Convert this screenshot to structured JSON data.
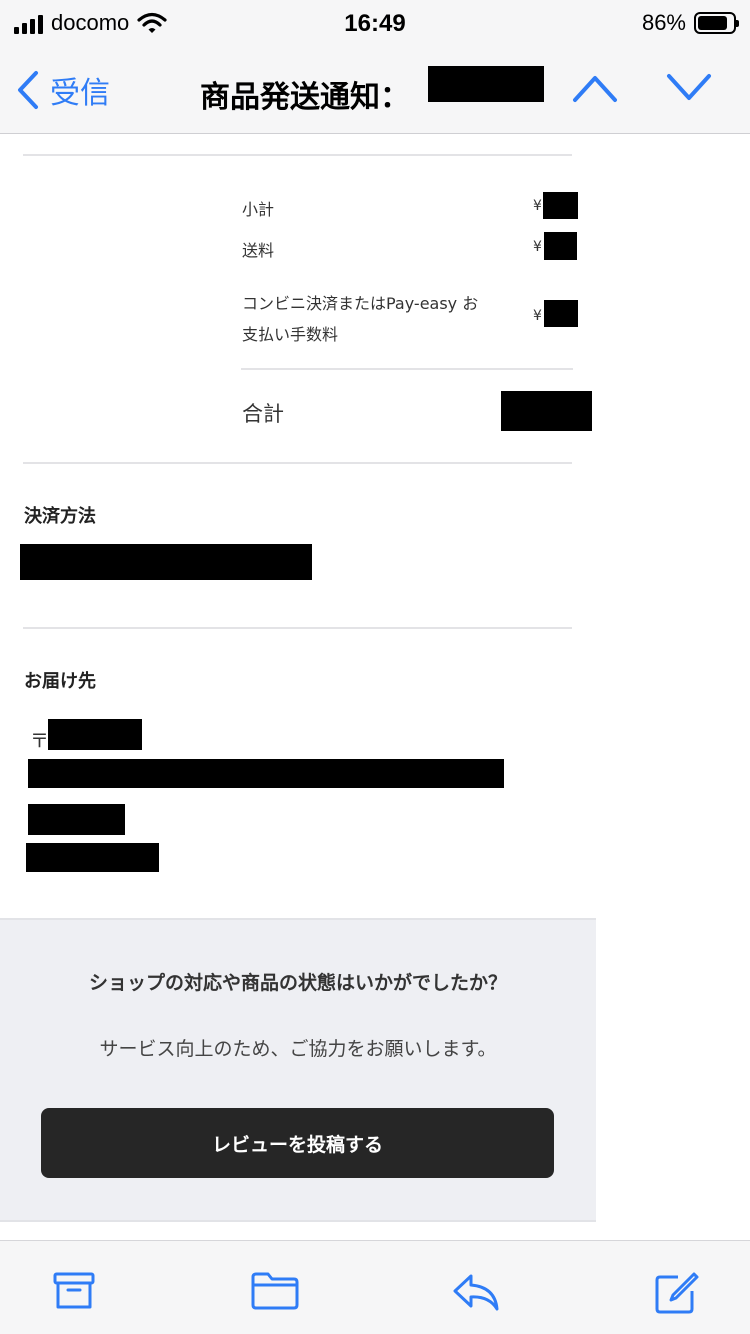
{
  "status_bar": {
    "carrier": "docomo",
    "time": "16:49",
    "battery": "86%",
    "battery_level": 0.86
  },
  "nav": {
    "back_label": "受信",
    "title": "商品発送通知："
  },
  "summary": {
    "subtotal_label": "小計",
    "shipping_label": "送料",
    "fee_label_line1": "コンビニ決済またはPay-easy お",
    "fee_label_line2": "支払い手数料",
    "currency": "¥",
    "total_label": "合計"
  },
  "payment": {
    "title": "決済方法"
  },
  "delivery": {
    "title": "お届け先",
    "postal_mark": "〒"
  },
  "review": {
    "question": "ショップの対応や商品の状態はいかがでしたか？",
    "subtext": "サービス向上のため、ご協力をお願いします。",
    "button_label": "レビューを投稿する"
  },
  "toolbar": {
    "icons": [
      "archive-icon",
      "folder-icon",
      "reply-icon",
      "compose-icon"
    ]
  },
  "colors": {
    "accent": "#2f7cf6",
    "button_bg": "#262626",
    "review_bg": "#eeeff3"
  }
}
